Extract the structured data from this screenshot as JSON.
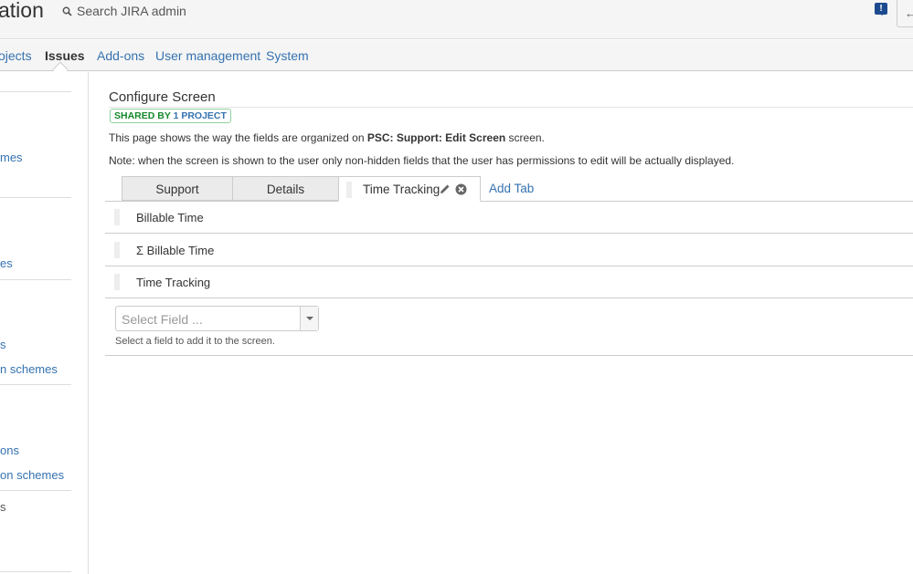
{
  "header": {
    "title": "ation",
    "search_placeholder": "Search JIRA admin",
    "feedback_icon": "!",
    "back_icon": "←"
  },
  "nav": {
    "items": [
      {
        "label": "ojects"
      },
      {
        "label": "Issues"
      },
      {
        "label": "Add-ons"
      },
      {
        "label": "User management"
      },
      {
        "label": "System"
      }
    ]
  },
  "sidebar": {
    "links": [
      "mes",
      "es",
      "s",
      "n schemes",
      "ons",
      "on schemes",
      "s"
    ]
  },
  "main": {
    "title": "Configure Screen",
    "badge_prefix": "SHARED BY ",
    "badge_link": "1 PROJECT",
    "desc_pre": "This page shows the way the fields are organized on ",
    "desc_bold": "PSC: Support: Edit Screen",
    "desc_post": " screen.",
    "note": "Note: when the screen is shown to the user only non-hidden fields that the user has permissions to edit will be actually displayed.",
    "tabs": [
      "Support",
      "Details",
      "Time Tracking"
    ],
    "add_tab": "Add Tab",
    "fields": [
      "Billable Time",
      "Σ Billable Time",
      "Time Tracking"
    ],
    "select_placeholder": "Select Field ...",
    "select_help": "Select a field to add it to the screen."
  }
}
